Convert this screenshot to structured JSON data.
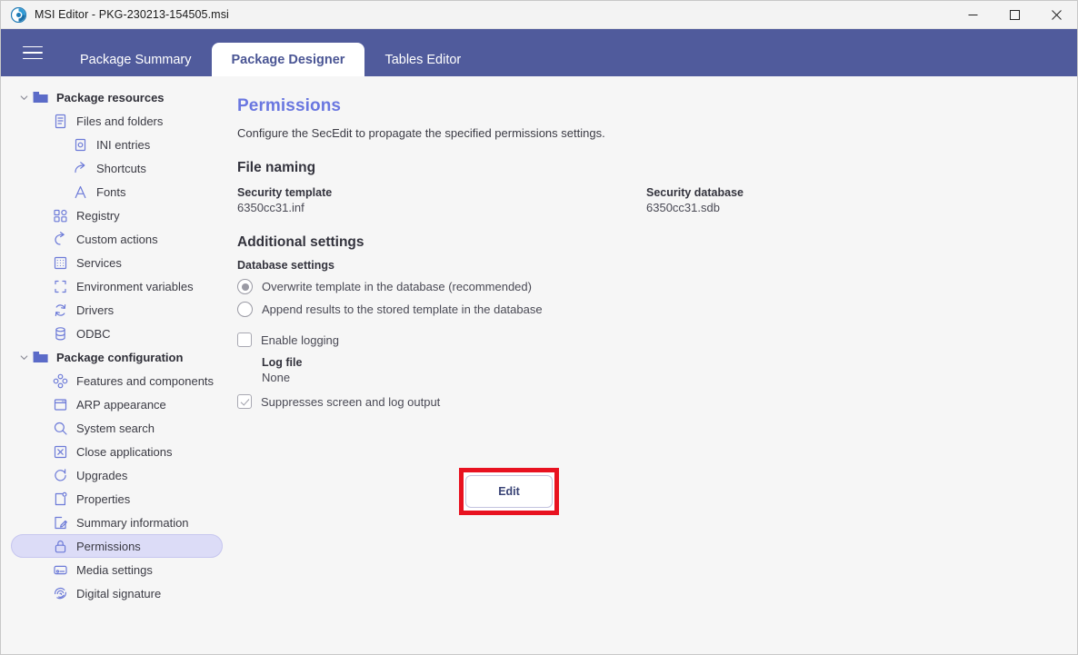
{
  "window": {
    "title": "MSI Editor - PKG-230213-154505.msi",
    "app_icon": "msi-editor-logo-icon",
    "controls": {
      "minimize": "minimize-icon",
      "maximize": "maximize-icon",
      "close": "close-icon"
    }
  },
  "header": {
    "menu_icon": "hamburger-menu-icon",
    "tabs": [
      {
        "label": "Package Summary",
        "active": false
      },
      {
        "label": "Package Designer",
        "active": true
      },
      {
        "label": "Tables Editor",
        "active": false
      }
    ]
  },
  "sidebar": {
    "items": [
      {
        "label": "Package resources",
        "icon": "folder-icon",
        "indent": 0,
        "group": true,
        "chevron": "chevron-down-icon",
        "selected": false
      },
      {
        "label": "Files and folders",
        "icon": "document-icon",
        "indent": 1,
        "group": false,
        "chevron": "",
        "selected": false
      },
      {
        "label": "INI entries",
        "icon": "ini-entries-icon",
        "indent": 2,
        "group": false,
        "chevron": "",
        "selected": false
      },
      {
        "label": "Shortcuts",
        "icon": "shortcut-arrow-icon",
        "indent": 2,
        "group": false,
        "chevron": "",
        "selected": false
      },
      {
        "label": "Fonts",
        "icon": "font-letter-a-icon",
        "indent": 2,
        "group": false,
        "chevron": "",
        "selected": false
      },
      {
        "label": "Registry",
        "icon": "registry-blocks-icon",
        "indent": 1,
        "group": false,
        "chevron": "",
        "selected": false
      },
      {
        "label": "Custom actions",
        "icon": "custom-actions-arrow-icon",
        "indent": 1,
        "group": false,
        "chevron": "",
        "selected": false
      },
      {
        "label": "Services",
        "icon": "services-grid-icon",
        "indent": 1,
        "group": false,
        "chevron": "",
        "selected": false
      },
      {
        "label": "Environment variables",
        "icon": "environment-brackets-icon",
        "indent": 1,
        "group": false,
        "chevron": "",
        "selected": false
      },
      {
        "label": "Drivers",
        "icon": "drivers-refresh-icon",
        "indent": 1,
        "group": false,
        "chevron": "",
        "selected": false
      },
      {
        "label": "ODBC",
        "icon": "database-cylinder-icon",
        "indent": 1,
        "group": false,
        "chevron": "",
        "selected": false
      },
      {
        "label": "Package configuration",
        "icon": "folder-icon",
        "indent": 0,
        "group": true,
        "chevron": "chevron-down-icon",
        "selected": false
      },
      {
        "label": "Features and components",
        "icon": "features-nodes-icon",
        "indent": 1,
        "group": false,
        "chevron": "",
        "selected": false
      },
      {
        "label": "ARP appearance",
        "icon": "arp-window-icon",
        "indent": 1,
        "group": false,
        "chevron": "",
        "selected": false
      },
      {
        "label": "System search",
        "icon": "search-icon",
        "indent": 1,
        "group": false,
        "chevron": "",
        "selected": false
      },
      {
        "label": "Close applications",
        "icon": "close-box-icon",
        "indent": 1,
        "group": false,
        "chevron": "",
        "selected": false
      },
      {
        "label": "Upgrades",
        "icon": "upgrade-refresh-icon",
        "indent": 1,
        "group": false,
        "chevron": "",
        "selected": false
      },
      {
        "label": "Properties",
        "icon": "properties-icon",
        "indent": 1,
        "group": false,
        "chevron": "",
        "selected": false
      },
      {
        "label": "Summary information",
        "icon": "summary-edit-icon",
        "indent": 1,
        "group": false,
        "chevron": "",
        "selected": false
      },
      {
        "label": "Permissions",
        "icon": "lock-icon",
        "indent": 1,
        "group": false,
        "chevron": "",
        "selected": true
      },
      {
        "label": "Media settings",
        "icon": "media-disk-icon",
        "indent": 1,
        "group": false,
        "chevron": "",
        "selected": false
      },
      {
        "label": "Digital signature",
        "icon": "fingerprint-icon",
        "indent": 1,
        "group": false,
        "chevron": "",
        "selected": false
      }
    ]
  },
  "main": {
    "title": "Permissions",
    "description": "Configure the SecEdit to propagate the specified permissions settings.",
    "file_naming": {
      "section_title": "File naming",
      "security_template_label": "Security template",
      "security_template_value": "6350cc31.inf",
      "security_database_label": "Security database",
      "security_database_value": "6350cc31.sdb"
    },
    "additional_settings": {
      "section_title": "Additional settings",
      "database_settings_label": "Database settings",
      "radios": [
        {
          "label": "Overwrite template in the database (recommended)",
          "checked": true
        },
        {
          "label": "Append results to the stored template in the database",
          "checked": false
        }
      ],
      "enable_logging": {
        "label": "Enable logging",
        "checked": false
      },
      "log_file_label": "Log file",
      "log_file_value": "None",
      "suppress_output": {
        "label": "Suppresses screen and log output",
        "checked": true
      }
    },
    "edit_button_label": "Edit"
  },
  "colors": {
    "header_purple": "#505b9c",
    "accent_blue": "#6a77e0",
    "icon_blue": "#6c7ad8",
    "folder_blue": "#5b6bc8",
    "selection_bg": "#dcdcf7",
    "highlight_red": "#e81220",
    "page_bg": "#f6f6f6"
  }
}
